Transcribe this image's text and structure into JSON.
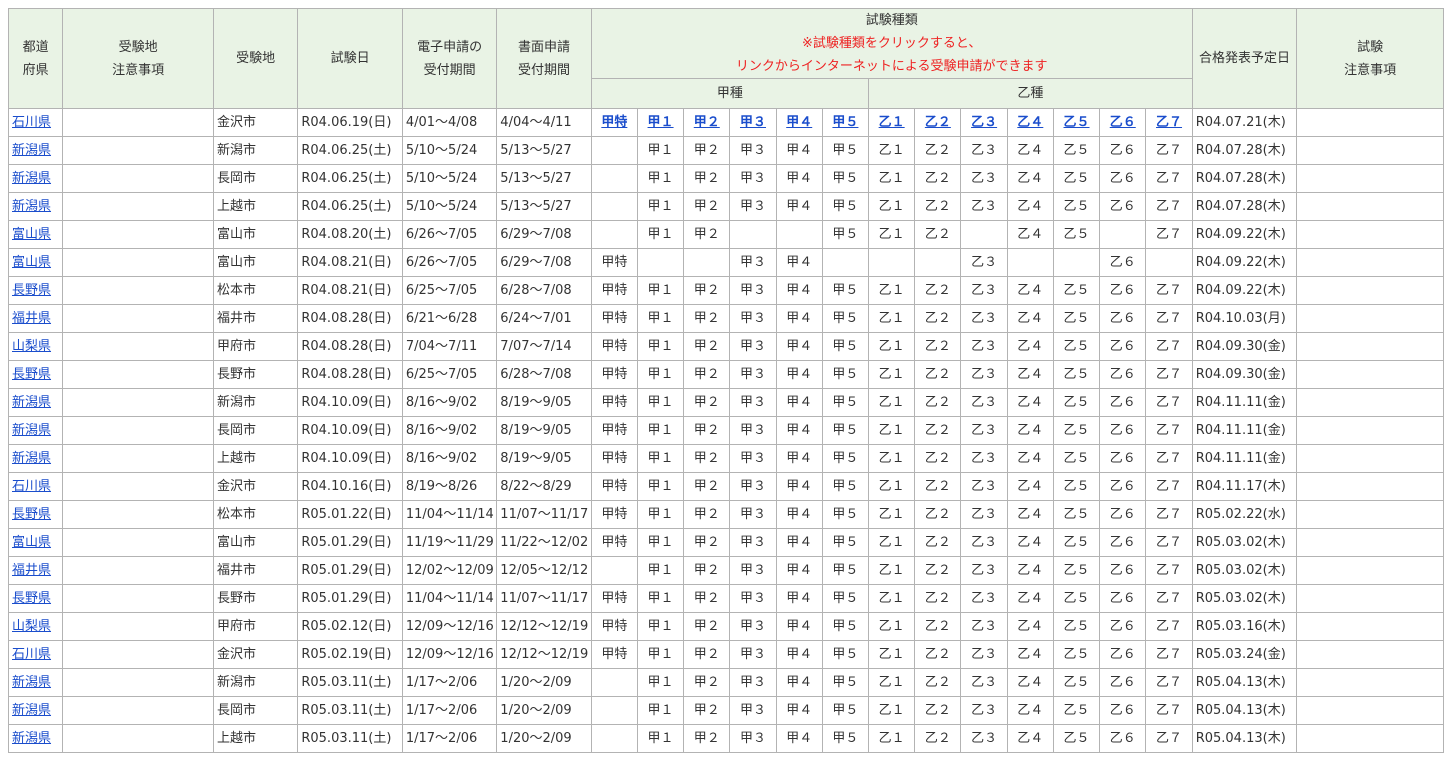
{
  "header": {
    "pref": [
      "都道",
      "府県"
    ],
    "site_note": [
      "受験地",
      "注意事項"
    ],
    "site": "受験地",
    "date": "試験日",
    "e_apply": [
      "電子申請の",
      "受付期間"
    ],
    "paper_apply": [
      "書面申請",
      "受付期間"
    ],
    "types_title": "試験種類",
    "types_note": [
      "※試験種類をクリックすると、",
      "リンクからインターネットによる受験申請ができます"
    ],
    "result_date": "合格発表予定日",
    "exam_note": [
      "試験",
      "注意事項"
    ],
    "ko": "甲種",
    "otsu": "乙種"
  },
  "link_color": "#1a4dcc",
  "header_bg": "#e9f3e5",
  "note_color": "#ee2222",
  "rows": [
    {
      "pref": "石川県",
      "site": "金沢市",
      "date": "R04.06.19(日)",
      "e": "4/01～4/08",
      "p": "4/04～4/11",
      "t": [
        "甲特",
        "甲１",
        "甲２",
        "甲３",
        "甲４",
        "甲５",
        "乙１",
        "乙２",
        "乙３",
        "乙４",
        "乙５",
        "乙６",
        "乙７"
      ],
      "linked": true,
      "result": "R04.07.21(木)"
    },
    {
      "pref": "新潟県",
      "site": "新潟市",
      "date": "R04.06.25(土)",
      "e": "5/10～5/24",
      "p": "5/13～5/27",
      "t": [
        "",
        "甲１",
        "甲２",
        "甲３",
        "甲４",
        "甲５",
        "乙１",
        "乙２",
        "乙３",
        "乙４",
        "乙５",
        "乙６",
        "乙７"
      ],
      "linked": false,
      "result": "R04.07.28(木)"
    },
    {
      "pref": "新潟県",
      "site": "長岡市",
      "date": "R04.06.25(土)",
      "e": "5/10～5/24",
      "p": "5/13～5/27",
      "t": [
        "",
        "甲１",
        "甲２",
        "甲３",
        "甲４",
        "甲５",
        "乙１",
        "乙２",
        "乙３",
        "乙４",
        "乙５",
        "乙６",
        "乙７"
      ],
      "linked": false,
      "result": "R04.07.28(木)"
    },
    {
      "pref": "新潟県",
      "site": "上越市",
      "date": "R04.06.25(土)",
      "e": "5/10～5/24",
      "p": "5/13～5/27",
      "t": [
        "",
        "甲１",
        "甲２",
        "甲３",
        "甲４",
        "甲５",
        "乙１",
        "乙２",
        "乙３",
        "乙４",
        "乙５",
        "乙６",
        "乙７"
      ],
      "linked": false,
      "result": "R04.07.28(木)"
    },
    {
      "pref": "富山県",
      "site": "富山市",
      "date": "R04.08.20(土)",
      "e": "6/26～7/05",
      "p": "6/29～7/08",
      "t": [
        "",
        "甲１",
        "甲２",
        "",
        "",
        "甲５",
        "乙１",
        "乙２",
        "",
        "乙４",
        "乙５",
        "",
        "乙７"
      ],
      "linked": false,
      "result": "R04.09.22(木)"
    },
    {
      "pref": "富山県",
      "site": "富山市",
      "date": "R04.08.21(日)",
      "e": "6/26～7/05",
      "p": "6/29～7/08",
      "t": [
        "甲特",
        "",
        "",
        "甲３",
        "甲４",
        "",
        "",
        "",
        "乙３",
        "",
        "",
        "乙６",
        ""
      ],
      "linked": false,
      "result": "R04.09.22(木)"
    },
    {
      "pref": "長野県",
      "site": "松本市",
      "date": "R04.08.21(日)",
      "e": "6/25～7/05",
      "p": "6/28～7/08",
      "t": [
        "甲特",
        "甲１",
        "甲２",
        "甲３",
        "甲４",
        "甲５",
        "乙１",
        "乙２",
        "乙３",
        "乙４",
        "乙５",
        "乙６",
        "乙７"
      ],
      "linked": false,
      "result": "R04.09.22(木)"
    },
    {
      "pref": "福井県",
      "site": "福井市",
      "date": "R04.08.28(日)",
      "e": "6/21～6/28",
      "p": "6/24～7/01",
      "t": [
        "甲特",
        "甲１",
        "甲２",
        "甲３",
        "甲４",
        "甲５",
        "乙１",
        "乙２",
        "乙３",
        "乙４",
        "乙５",
        "乙６",
        "乙７"
      ],
      "linked": false,
      "result": "R04.10.03(月)"
    },
    {
      "pref": "山梨県",
      "site": "甲府市",
      "date": "R04.08.28(日)",
      "e": "7/04～7/11",
      "p": "7/07～7/14",
      "t": [
        "甲特",
        "甲１",
        "甲２",
        "甲３",
        "甲４",
        "甲５",
        "乙１",
        "乙２",
        "乙３",
        "乙４",
        "乙５",
        "乙６",
        "乙７"
      ],
      "linked": false,
      "result": "R04.09.30(金)"
    },
    {
      "pref": "長野県",
      "site": "長野市",
      "date": "R04.08.28(日)",
      "e": "6/25～7/05",
      "p": "6/28～7/08",
      "t": [
        "甲特",
        "甲１",
        "甲２",
        "甲３",
        "甲４",
        "甲５",
        "乙１",
        "乙２",
        "乙３",
        "乙４",
        "乙５",
        "乙６",
        "乙７"
      ],
      "linked": false,
      "result": "R04.09.30(金)"
    },
    {
      "pref": "新潟県",
      "site": "新潟市",
      "date": "R04.10.09(日)",
      "e": "8/16～9/02",
      "p": "8/19～9/05",
      "t": [
        "甲特",
        "甲１",
        "甲２",
        "甲３",
        "甲４",
        "甲５",
        "乙１",
        "乙２",
        "乙３",
        "乙４",
        "乙５",
        "乙６",
        "乙７"
      ],
      "linked": false,
      "result": "R04.11.11(金)"
    },
    {
      "pref": "新潟県",
      "site": "長岡市",
      "date": "R04.10.09(日)",
      "e": "8/16～9/02",
      "p": "8/19～9/05",
      "t": [
        "甲特",
        "甲１",
        "甲２",
        "甲３",
        "甲４",
        "甲５",
        "乙１",
        "乙２",
        "乙３",
        "乙４",
        "乙５",
        "乙６",
        "乙７"
      ],
      "linked": false,
      "result": "R04.11.11(金)"
    },
    {
      "pref": "新潟県",
      "site": "上越市",
      "date": "R04.10.09(日)",
      "e": "8/16～9/02",
      "p": "8/19～9/05",
      "t": [
        "甲特",
        "甲１",
        "甲２",
        "甲３",
        "甲４",
        "甲５",
        "乙１",
        "乙２",
        "乙３",
        "乙４",
        "乙５",
        "乙６",
        "乙７"
      ],
      "linked": false,
      "result": "R04.11.11(金)"
    },
    {
      "pref": "石川県",
      "site": "金沢市",
      "date": "R04.10.16(日)",
      "e": "8/19～8/26",
      "p": "8/22～8/29",
      "t": [
        "甲特",
        "甲１",
        "甲２",
        "甲３",
        "甲４",
        "甲５",
        "乙１",
        "乙２",
        "乙３",
        "乙４",
        "乙５",
        "乙６",
        "乙７"
      ],
      "linked": false,
      "result": "R04.11.17(木)"
    },
    {
      "pref": "長野県",
      "site": "松本市",
      "date": "R05.01.22(日)",
      "e": "11/04～11/14",
      "p": "11/07～11/17",
      "t": [
        "甲特",
        "甲１",
        "甲２",
        "甲３",
        "甲４",
        "甲５",
        "乙１",
        "乙２",
        "乙３",
        "乙４",
        "乙５",
        "乙６",
        "乙７"
      ],
      "linked": false,
      "result": "R05.02.22(水)"
    },
    {
      "pref": "富山県",
      "site": "富山市",
      "date": "R05.01.29(日)",
      "e": "11/19～11/29",
      "p": "11/22～12/02",
      "t": [
        "甲特",
        "甲１",
        "甲２",
        "甲３",
        "甲４",
        "甲５",
        "乙１",
        "乙２",
        "乙３",
        "乙４",
        "乙５",
        "乙６",
        "乙７"
      ],
      "linked": false,
      "result": "R05.03.02(木)"
    },
    {
      "pref": "福井県",
      "site": "福井市",
      "date": "R05.01.29(日)",
      "e": "12/02～12/09",
      "p": "12/05～12/12",
      "t": [
        "",
        "甲１",
        "甲２",
        "甲３",
        "甲４",
        "甲５",
        "乙１",
        "乙２",
        "乙３",
        "乙４",
        "乙５",
        "乙６",
        "乙７"
      ],
      "linked": false,
      "result": "R05.03.02(木)"
    },
    {
      "pref": "長野県",
      "site": "長野市",
      "date": "R05.01.29(日)",
      "e": "11/04～11/14",
      "p": "11/07～11/17",
      "t": [
        "甲特",
        "甲１",
        "甲２",
        "甲３",
        "甲４",
        "甲５",
        "乙１",
        "乙２",
        "乙３",
        "乙４",
        "乙５",
        "乙６",
        "乙７"
      ],
      "linked": false,
      "result": "R05.03.02(木)"
    },
    {
      "pref": "山梨県",
      "site": "甲府市",
      "date": "R05.02.12(日)",
      "e": "12/09～12/16",
      "p": "12/12～12/19",
      "t": [
        "甲特",
        "甲１",
        "甲２",
        "甲３",
        "甲４",
        "甲５",
        "乙１",
        "乙２",
        "乙３",
        "乙４",
        "乙５",
        "乙６",
        "乙７"
      ],
      "linked": false,
      "result": "R05.03.16(木)"
    },
    {
      "pref": "石川県",
      "site": "金沢市",
      "date": "R05.02.19(日)",
      "e": "12/09～12/16",
      "p": "12/12～12/19",
      "t": [
        "甲特",
        "甲１",
        "甲２",
        "甲３",
        "甲４",
        "甲５",
        "乙１",
        "乙２",
        "乙３",
        "乙４",
        "乙５",
        "乙６",
        "乙７"
      ],
      "linked": false,
      "result": "R05.03.24(金)"
    },
    {
      "pref": "新潟県",
      "site": "新潟市",
      "date": "R05.03.11(土)",
      "e": "1/17～2/06",
      "p": "1/20～2/09",
      "t": [
        "",
        "甲１",
        "甲２",
        "甲３",
        "甲４",
        "甲５",
        "乙１",
        "乙２",
        "乙３",
        "乙４",
        "乙５",
        "乙６",
        "乙７"
      ],
      "linked": false,
      "result": "R05.04.13(木)"
    },
    {
      "pref": "新潟県",
      "site": "長岡市",
      "date": "R05.03.11(土)",
      "e": "1/17～2/06",
      "p": "1/20～2/09",
      "t": [
        "",
        "甲１",
        "甲２",
        "甲３",
        "甲４",
        "甲５",
        "乙１",
        "乙２",
        "乙３",
        "乙４",
        "乙５",
        "乙６",
        "乙７"
      ],
      "linked": false,
      "result": "R05.04.13(木)"
    },
    {
      "pref": "新潟県",
      "site": "上越市",
      "date": "R05.03.11(土)",
      "e": "1/17～2/06",
      "p": "1/20～2/09",
      "t": [
        "",
        "甲１",
        "甲２",
        "甲３",
        "甲４",
        "甲５",
        "乙１",
        "乙２",
        "乙３",
        "乙４",
        "乙５",
        "乙６",
        "乙７"
      ],
      "linked": false,
      "result": "R05.04.13(木)"
    }
  ]
}
